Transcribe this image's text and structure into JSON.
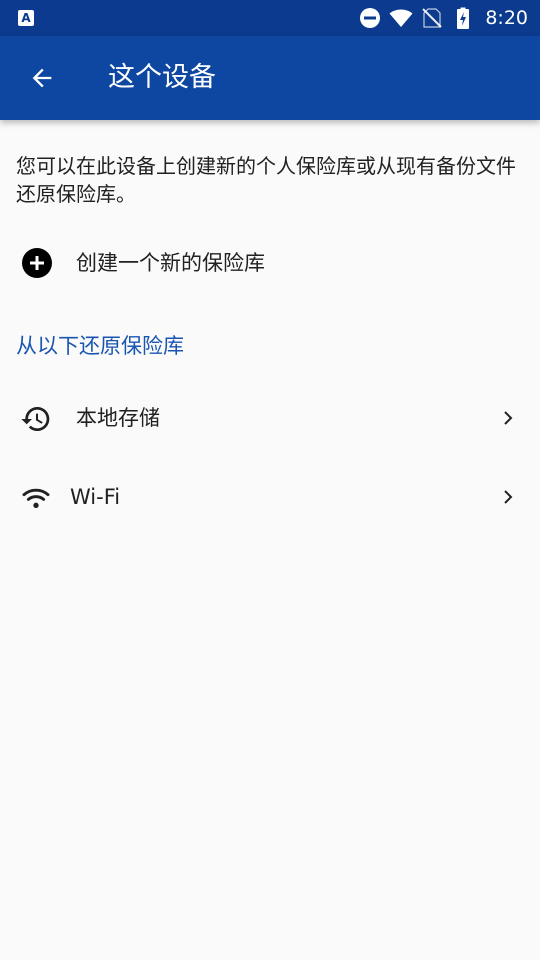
{
  "status_bar": {
    "app_icon_letter": "A",
    "time": "8:20",
    "icons": [
      "app-notification-icon",
      "do-not-disturb-icon",
      "wifi-signal-icon",
      "no-sim-icon",
      "battery-charging-icon"
    ]
  },
  "app_bar": {
    "title": "这个设备",
    "back_icon": "arrow-back-icon"
  },
  "intro_text": "您可以在此设备上创建新的个人保险库或从现有备份文件还原保险库。",
  "create_action": {
    "label": "创建一个新的保险库",
    "icon": "add-circle-icon"
  },
  "restore_section": {
    "title": "从以下还原保险库",
    "items": [
      {
        "label": "本地存储",
        "icon": "history-icon"
      },
      {
        "label": "Wi-Fi",
        "icon": "wifi-icon"
      }
    ]
  },
  "colors": {
    "status_bar": "#0b3a8e",
    "app_bar": "#0d47a1",
    "section_title": "#1a56b0",
    "background": "#fafafa",
    "text": "#212121"
  }
}
